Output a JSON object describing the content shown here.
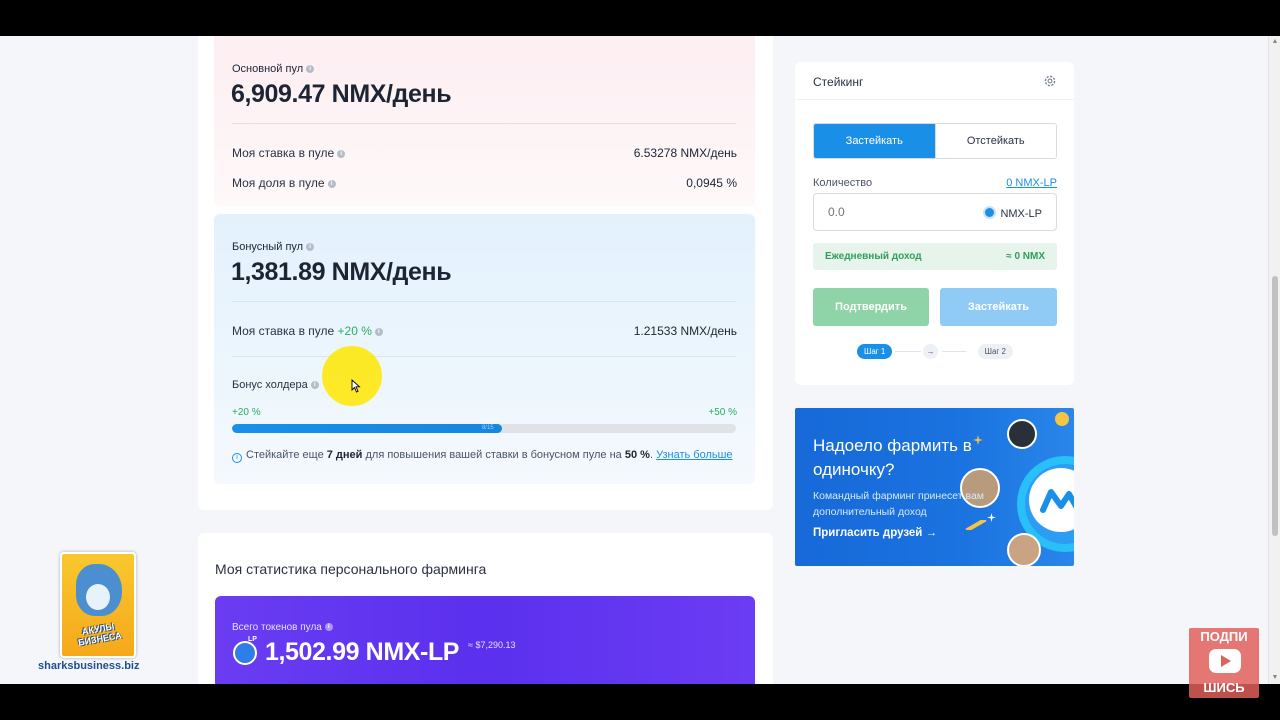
{
  "main_pool": {
    "title": "Основной пул",
    "amount": "6,909.47 NMX/день",
    "my_stake_label": "Моя ставка в пуле",
    "my_stake_value": "6.53278 NMX/день",
    "my_share_label": "Моя доля в пуле",
    "my_share_value": "0,0945 %"
  },
  "bonus_pool": {
    "title": "Бонусный пул",
    "amount": "1,381.89 NMX/день",
    "my_stake_label": "Моя ставка в пуле",
    "my_stake_bonus": "+20 %",
    "my_stake_value": "1.21533 NMX/день",
    "holder_bonus_label": "Бонус холдера",
    "range_min": "+20 %",
    "range_max": "+50 %",
    "progress_text": "8/15",
    "progress_fraction": 0.535,
    "note_prefix": "Стейкайте еще",
    "note_days": "7 дней",
    "note_mid": "для повышения вашей ставки в бонусном пуле на",
    "note_pct": "50 %",
    "note_end": ".",
    "note_link": "Узнать больше"
  },
  "stats": {
    "title": "Моя статистика персонального фарминга",
    "total_label": "Всего токенов пула",
    "lp_tag": "LP",
    "total_amount": "1,502.99 NMX-LP",
    "total_usd": "≈ $7,290.13"
  },
  "staking": {
    "title": "Стейкинг",
    "tab_stake": "Застейкать",
    "tab_unstake": "Отстейкать",
    "qty_label": "Количество",
    "qty_max": "0 NMX-LP",
    "qty_placeholder": "0.0",
    "token": "NMX-LP",
    "daily_label": "Ежедневный доход",
    "daily_value": "≈ 0 NMX",
    "confirm_button": "Подтвердить",
    "stake_button": "Застейкать",
    "step1": "Шаг 1",
    "step_arrow": "→",
    "step2": "Шаг 2"
  },
  "promo": {
    "heading": "Надоело фармить в одиночку?",
    "subtext": "Командный фарминг принесет вам дополнительный доход",
    "cta": "Пригласить друзей →"
  },
  "overlays": {
    "shark_title": "АКУЛЫ БИЗНЕСА",
    "shark_site": "sharksbusiness.biz",
    "subscribe_top": "ПОДПИ",
    "subscribe_bottom": "ШИСЬ"
  },
  "colors": {
    "accent": "#1a8fe8",
    "green": "#27ae60",
    "purple": "#5b30ee"
  }
}
